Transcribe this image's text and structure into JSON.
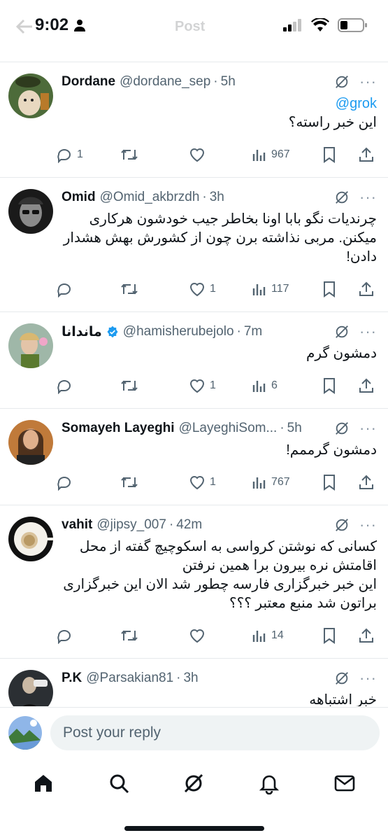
{
  "status": {
    "time": "9:02"
  },
  "header": {
    "title": "Post"
  },
  "tweets": [
    {
      "name": "Dordane",
      "handle": "@dordane_sep",
      "time": "5h",
      "mention": "@grok",
      "text": "این خبر راسته؟",
      "replies": "1",
      "retweets": "",
      "likes": "",
      "views": "967"
    },
    {
      "name": "Omid",
      "handle": "@Omid_akbrzdh",
      "time": "3h",
      "text": "چرندیات نگو بابا اونا بخاطر جیب خودشون هرکاری میکنن. مربی نذاشته برن چون از کشورش بهش هشدار دادن!",
      "replies": "",
      "retweets": "",
      "likes": "1",
      "views": "117"
    },
    {
      "name": "ماندانا",
      "handle": "@hamisherubejolo",
      "time": "7m",
      "text": "دمشون گرم",
      "replies": "",
      "retweets": "",
      "likes": "1",
      "views": "6"
    },
    {
      "name": "Somayeh Layeghi",
      "handle": "@LayeghiSom...",
      "time": "5h",
      "text": "دمشون گرممم!",
      "replies": "",
      "retweets": "",
      "likes": "1",
      "views": "767"
    },
    {
      "name": "vahit",
      "handle": "@jipsy_007",
      "time": "42m",
      "text": "کسانی که نوشتن کرواسی به اسکوچیچ گفته از محل اقامتش نره بیرون برا همین نرفتن\nاین خبر خبرگزاری فارسه چطور شد الان این خبرگزاری براتون شد منبع معتبر ؟؟؟",
      "replies": "",
      "retweets": "",
      "likes": "",
      "views": "14"
    },
    {
      "name": "P.K",
      "handle": "@Parsakian81",
      "time": "3h",
      "text": "خبر اشتباهه\nسفارت کرواسی به سرمربی تراکتور گفته به هیچ وجه از خونت خارج نشو\nنه اینکه همراه تیم",
      "replies": "",
      "retweets": "",
      "likes": "",
      "views": ""
    }
  ],
  "reply": {
    "placeholder": "Post your reply"
  },
  "nav": [
    "home-icon",
    "search-icon",
    "grok-icon",
    "notifications-icon",
    "messages-icon"
  ]
}
